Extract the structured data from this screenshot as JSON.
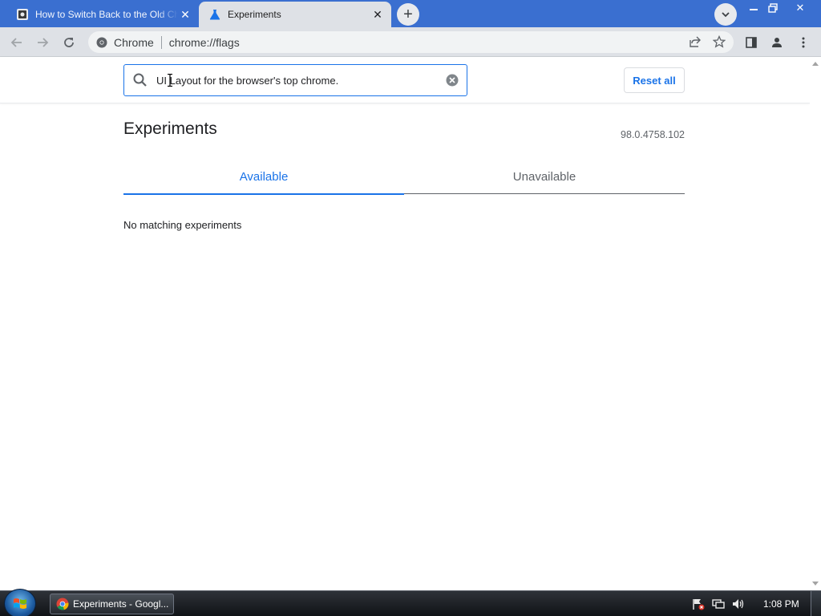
{
  "browser": {
    "tabs": [
      {
        "title": "How to Switch Back to the Old Chrome",
        "favicon": "site-square-icon",
        "active": false
      },
      {
        "title": "Experiments",
        "favicon": "flask-icon",
        "active": true
      }
    ],
    "new_tab_label": "+",
    "window_controls": [
      "minimize",
      "restore",
      "close"
    ]
  },
  "toolbar": {
    "site_chip": "Chrome",
    "url": "chrome://flags"
  },
  "flags_page": {
    "search_value": "UI Layout for the browser's top chrome.",
    "reset_all_label": "Reset all",
    "heading": "Experiments",
    "version": "98.0.4758.102",
    "tabs": [
      "Available",
      "Unavailable"
    ],
    "active_tab": "Available",
    "empty_message": "No matching experiments"
  },
  "taskbar": {
    "window_title": "Experiments - Googl...",
    "clock": "1:08 PM"
  },
  "colors": {
    "accent": "#1a73e8",
    "title_bar": "#3a6fd0",
    "toolbar": "#dee1e6"
  }
}
